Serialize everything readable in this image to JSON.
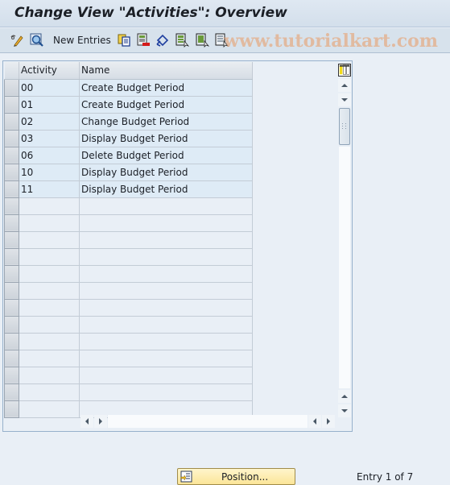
{
  "window": {
    "title": "Change View \"Activities\": Overview"
  },
  "toolbar": {
    "icons": [
      "display-change-icon",
      "details-icon",
      "copy-as-icon",
      "delete-icon",
      "undo-change-icon",
      "select-all-icon",
      "select-block-icon",
      "deselect-all-icon"
    ],
    "new_entries_label": "New Entries",
    "watermark": "www.tutorialkart.com"
  },
  "table": {
    "columns": [
      "Activity",
      "Name"
    ],
    "rows": [
      {
        "activity": "00",
        "name": "Create Budget Period"
      },
      {
        "activity": "01",
        "name": "Create Budget Period"
      },
      {
        "activity": "02",
        "name": "Change Budget Period"
      },
      {
        "activity": "03",
        "name": "Display Budget Period"
      },
      {
        "activity": "06",
        "name": "Delete Budget Period"
      },
      {
        "activity": "10",
        "name": "Display Budget Period"
      },
      {
        "activity": "11",
        "name": "Display Budget Period"
      }
    ],
    "visible_row_count": 20
  },
  "footer": {
    "position_button_label": "Position...",
    "entry_status": "Entry 1 of 7"
  }
}
